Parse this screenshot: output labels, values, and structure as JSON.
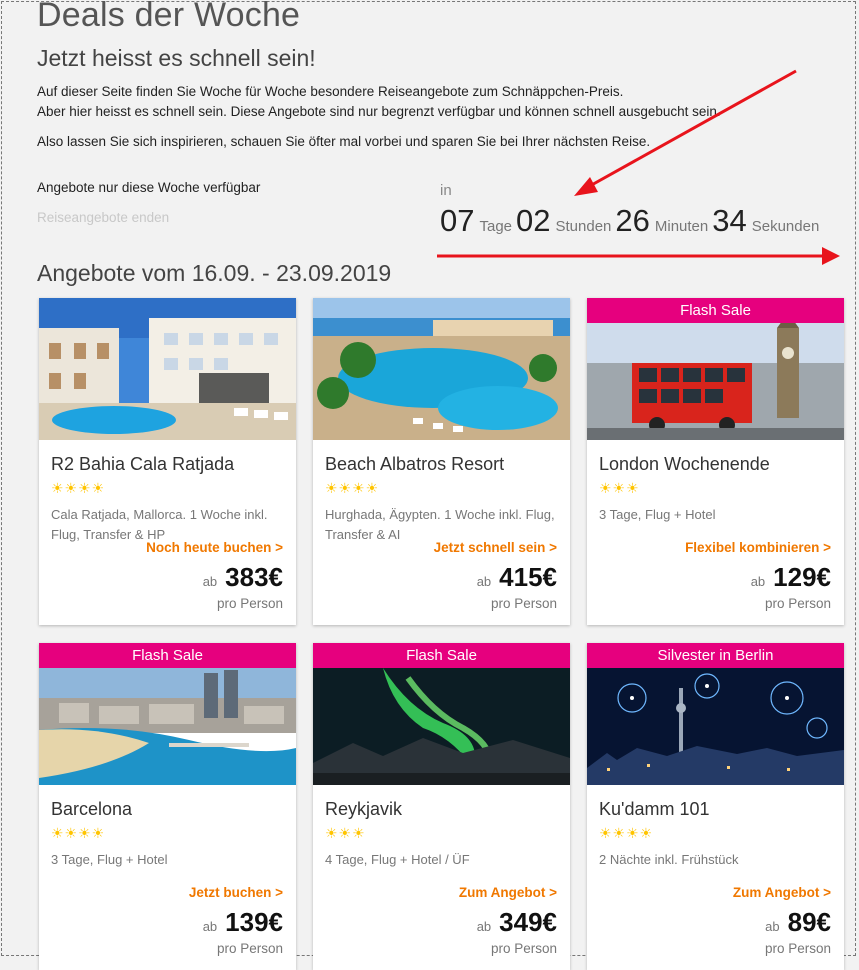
{
  "header": {
    "title": "Deals der Woche",
    "subtitle": "Jetzt heisst es schnell sein!",
    "intro_line1": "Auf dieser Seite finden Sie Woche für Woche besondere Reiseangebote zum Schnäppchen-Preis.",
    "intro_line2": "Aber hier heisst es schnell sein. Diese Angebote sind nur begrenzt verfügbar und können schnell ausgebucht sein.",
    "intro_line3": "Also lassen Sie sich inspirieren, schauen Sie öfter mal vorbei und sparen Sie bei Ihrer nächsten Reise."
  },
  "availability": {
    "label": "Angebote nur diese Woche verfügbar",
    "ends_label": "Reiseangebote enden"
  },
  "countdown": {
    "prefix": "in",
    "days": "07",
    "days_unit": "Tage",
    "hours": "02",
    "hours_unit": "Stunden",
    "minutes": "26",
    "minutes_unit": "Minuten",
    "seconds": "34",
    "seconds_unit": "Sekunden"
  },
  "annotations": {
    "arrow_color": "#e8141c"
  },
  "offers": {
    "title": "Angebote vom 16.09. - 23.09.2019",
    "badge_color": "#e6007e",
    "cta_color": "#f07800",
    "cards": [
      {
        "badge": "",
        "image": "hotel-pool",
        "name": "R2 Bahia Cala Ratjada",
        "stars": "☀☀☀☀",
        "star_count": 4,
        "desc": "Cala Ratjada, Mallorca. 1 Woche inkl. Flug, Transfer & HP",
        "cta": "Noch heute buchen >",
        "ab": "ab",
        "price": "383€",
        "per": "pro Person"
      },
      {
        "badge": "",
        "image": "resort-pool",
        "name": "Beach Albatros Resort",
        "stars": "☀☀☀☀",
        "star_count": 4,
        "desc": "Hurghada, Ägypten. 1 Woche inkl. Flug, Transfer & AI",
        "cta": "Jetzt schnell sein >",
        "ab": "ab",
        "price": "415€",
        "per": "pro Person"
      },
      {
        "badge": "Flash Sale",
        "image": "london-bus",
        "name": "London Wochenende",
        "stars": "☀☀☀",
        "star_count": 3,
        "desc": "3 Tage, Flug + Hotel",
        "cta": "Flexibel kombinieren >",
        "ab": "ab",
        "price": "129€",
        "per": "pro Person"
      },
      {
        "badge": "Flash Sale",
        "image": "barcelona-beach",
        "name": "Barcelona",
        "stars": "☀☀☀☀",
        "star_count": 4,
        "desc": "3 Tage, Flug + Hotel",
        "cta": "Jetzt buchen >",
        "ab": "ab",
        "price": "139€",
        "per": "pro Person"
      },
      {
        "badge": "Flash Sale",
        "image": "aurora",
        "name": "Reykjavik",
        "stars": "☀☀☀",
        "star_count": 3,
        "desc": "4 Tage, Flug + Hotel / ÜF",
        "cta": "Zum Angebot >",
        "ab": "ab",
        "price": "349€",
        "per": "pro Person"
      },
      {
        "badge": "Silvester in Berlin",
        "image": "berlin-fireworks",
        "name": "Ku'damm 101",
        "stars": "☀☀☀☀",
        "star_count": 4,
        "desc": "2 Nächte inkl. Frühstück",
        "cta": "Zum Angebot >",
        "ab": "ab",
        "price": "89€",
        "per": "pro Person"
      }
    ]
  }
}
